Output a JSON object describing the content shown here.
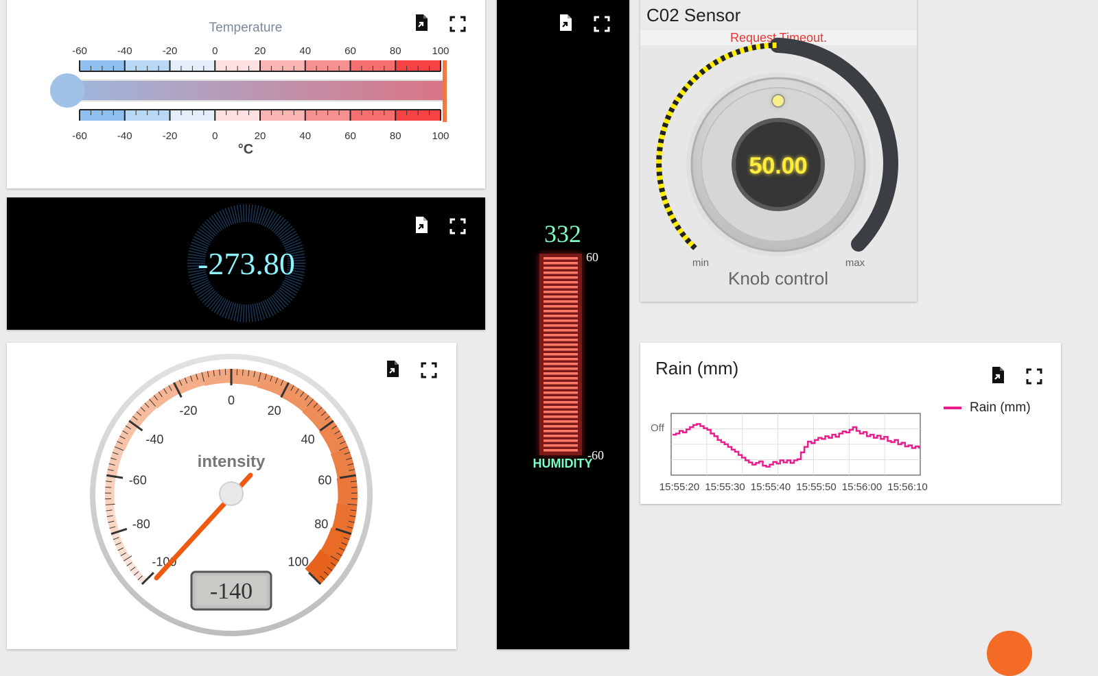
{
  "temperature": {
    "title": "Temperature",
    "unit": "°C",
    "scale_labels": [
      "-60",
      "-40",
      "-20",
      "0",
      "20",
      "40",
      "60",
      "80",
      "100"
    ]
  },
  "digital": {
    "value": "-273.80"
  },
  "intensity": {
    "title": "intensity",
    "value_display": "-140",
    "scale_labels": [
      "-100",
      "-80",
      "-60",
      "-40",
      "-20",
      "0",
      "20",
      "40",
      "60",
      "80",
      "100"
    ]
  },
  "humidity": {
    "value": "332",
    "label": "HUMIDITY",
    "max_label": "60",
    "min_label": "-60"
  },
  "co2": {
    "title": "C02 Sensor",
    "error": "Request Timeout.",
    "value": "50.00",
    "min_label": "min",
    "max_label": "max",
    "caption": "Knob control"
  },
  "rain": {
    "title": "Rain (mm)",
    "legend": "Rain (mm)"
  },
  "chart_data": {
    "type": "line",
    "title": "Rain (mm)",
    "ytick": "Off",
    "x_ticks": [
      "15:55:20",
      "15:55:30",
      "15:55:40",
      "15:55:50",
      "15:56:00",
      "15:56:10"
    ],
    "series": [
      {
        "name": "Rain (mm)",
        "color": "#e91e8c",
        "values": [
          0.18,
          0.2,
          0.25,
          0.22,
          0.28,
          0.32,
          0.36,
          0.38,
          0.34,
          0.3,
          0.27,
          0.2,
          0.15,
          0.08,
          0.04,
          0.0,
          -0.05,
          -0.1,
          -0.14,
          -0.2,
          -0.25,
          -0.3,
          -0.34,
          -0.38,
          -0.35,
          -0.32,
          -0.4,
          -0.42,
          -0.38,
          -0.33,
          -0.36,
          -0.3,
          -0.34,
          -0.3,
          -0.35,
          -0.3,
          -0.28,
          -0.15,
          -0.05,
          0.05,
          0.02,
          0.08,
          0.12,
          0.1,
          0.15,
          0.12,
          0.18,
          0.14,
          0.2,
          0.24,
          0.22,
          0.27,
          0.32,
          0.25,
          0.2,
          0.23,
          0.15,
          0.18,
          0.12,
          0.16,
          0.1,
          0.14,
          0.06,
          0.04,
          0.08,
          0.0,
          0.03,
          -0.04,
          -0.02,
          -0.07,
          -0.04,
          -0.08
        ]
      }
    ],
    "colors": {
      "accent": "#e91e8c"
    }
  }
}
